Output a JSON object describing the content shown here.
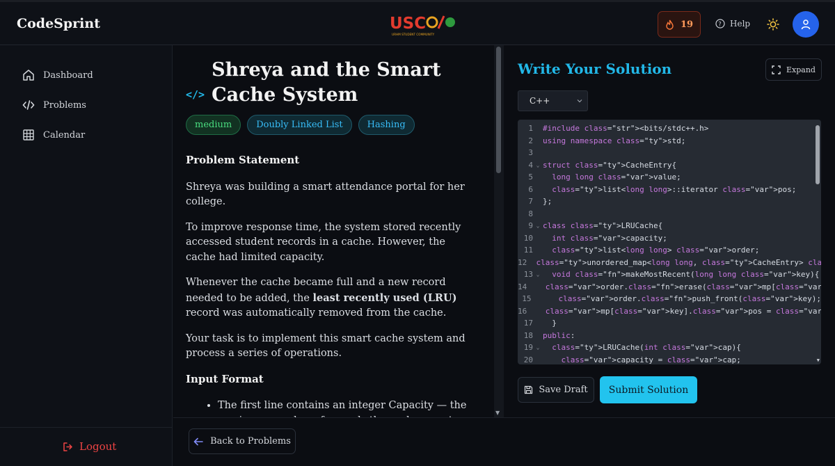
{
  "header": {
    "brand": "CodeSprint",
    "logo_text": "USC",
    "logo_subtext": "URHM STUDENT COMMUNITY",
    "streak_count": "19",
    "help_label": "Help",
    "icons": [
      "fire-icon",
      "help-icon",
      "sun-icon",
      "user-icon"
    ]
  },
  "sidebar": {
    "items": [
      {
        "label": "Dashboard",
        "icon": "home-icon"
      },
      {
        "label": "Problems",
        "icon": "code-icon"
      },
      {
        "label": "Calendar",
        "icon": "calendar-icon"
      }
    ],
    "logout_label": "Logout"
  },
  "problem": {
    "title": "Shreya and the Smart Cache System",
    "tags": [
      "medium",
      "Doubly Linked List",
      "Hashing"
    ],
    "statement_heading": "Problem Statement",
    "paragraphs": [
      "Shreya was building a smart attendance portal for her college.",
      "To improve response time, the system stored recently accessed student records in a cache. However, the cache had limited capacity.",
      "Your task is to implement this smart cache system and process a series of operations."
    ],
    "lru_paragraph": {
      "before": "Whenever the cache became full and a new record needed to be added, the ",
      "bold": "least recently used (LRU)",
      "after": " record was automatically removed from the cache."
    },
    "input_heading": "Input Format",
    "input_items": [
      "The first line contains an integer Capacity — the maximum number of records the cache can store."
    ]
  },
  "editor": {
    "title": "Write Your Solution",
    "expand_label": "Expand",
    "language": "C++",
    "save_label": "Save Draft",
    "submit_label": "Submit Solution"
  },
  "code_lines": [
    {
      "n": "1",
      "fold": false,
      "text": "#include <bits/stdc++.h>"
    },
    {
      "n": "2",
      "fold": false,
      "text": "using namespace std;"
    },
    {
      "n": "3",
      "fold": false,
      "text": ""
    },
    {
      "n": "4",
      "fold": true,
      "text": "struct CacheEntry{"
    },
    {
      "n": "5",
      "fold": false,
      "text": "  long long value;"
    },
    {
      "n": "6",
      "fold": false,
      "text": "  list<long long>::iterator pos;"
    },
    {
      "n": "7",
      "fold": false,
      "text": "};"
    },
    {
      "n": "8",
      "fold": false,
      "text": ""
    },
    {
      "n": "9",
      "fold": true,
      "text": "class LRUCache{"
    },
    {
      "n": "10",
      "fold": false,
      "text": "  int capacity;"
    },
    {
      "n": "11",
      "fold": false,
      "text": "  list<long long> order;"
    },
    {
      "n": "12",
      "fold": false,
      "text": "  unordered_map<long long, CacheEntry> mp;"
    },
    {
      "n": "13",
      "fold": true,
      "text": "  void makeMostRecent(long long key){"
    },
    {
      "n": "14",
      "fold": false,
      "text": "    order.erase(mp[key].pos);"
    },
    {
      "n": "15",
      "fold": false,
      "text": "    order.push_front(key);"
    },
    {
      "n": "16",
      "fold": false,
      "text": "    mp[key].pos = order.begin();"
    },
    {
      "n": "17",
      "fold": false,
      "text": "  }"
    },
    {
      "n": "18",
      "fold": false,
      "text": "public:"
    },
    {
      "n": "19",
      "fold": true,
      "text": "  LRUCache(int cap){"
    },
    {
      "n": "20",
      "fold": false,
      "text": "    capacity = cap;"
    }
  ],
  "footer": {
    "back_label": "Back to Problems"
  },
  "colors": {
    "accent": "#22b8e8",
    "submit": "#22c3ee",
    "logout": "#ef4444",
    "avatar": "#2563eb"
  }
}
